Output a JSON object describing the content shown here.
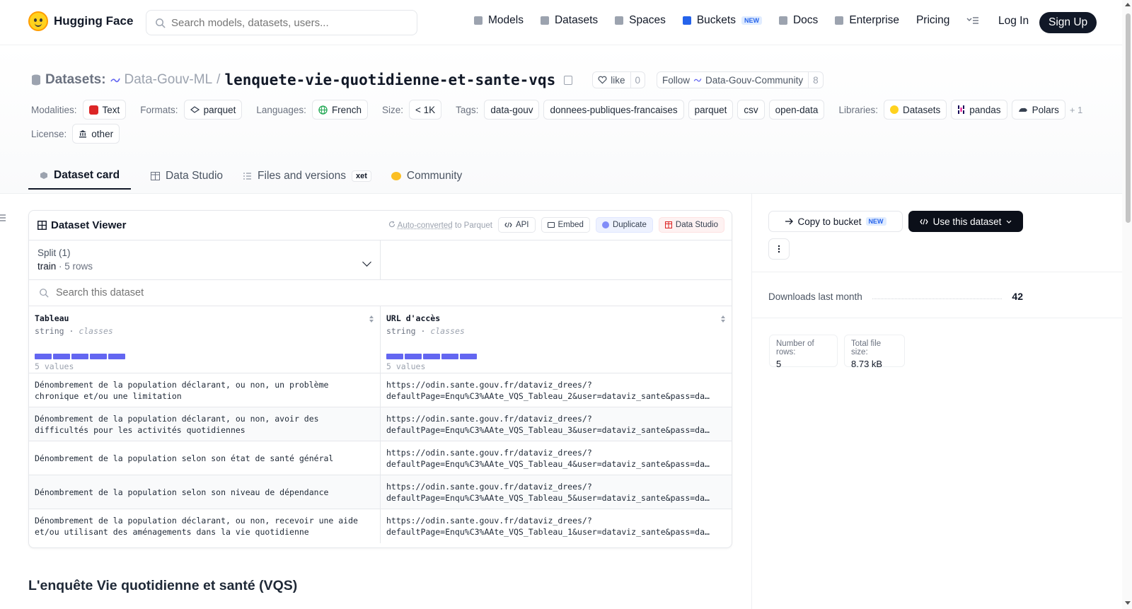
{
  "nav": {
    "brand": "Hugging Face",
    "search_placeholder": "Search models, datasets, users...",
    "links": [
      {
        "label": "Models"
      },
      {
        "label": "Datasets"
      },
      {
        "label": "Spaces"
      },
      {
        "label": "Buckets",
        "badge": "NEW"
      },
      {
        "label": "Docs"
      },
      {
        "label": "Enterprise"
      },
      {
        "label": "Pricing"
      }
    ],
    "login": "Log In",
    "signup": "Sign Up"
  },
  "repo": {
    "type_label": "Datasets:",
    "org": "Data-Gouv-ML",
    "separator": "/",
    "name": "lenquete-vie-quotidienne-et-sante-vqs",
    "like_label": "like",
    "like_count": "0",
    "follow_label": "Follow",
    "follow_org": "Data-Gouv-Community",
    "follow_count": "8"
  },
  "meta": {
    "modalities_label": "Modalities:",
    "modalities": "Text",
    "formats_label": "Formats:",
    "formats": "parquet",
    "languages_label": "Languages:",
    "languages": "French",
    "size_label": "Size:",
    "size": "< 1K",
    "tags_label": "Tags:",
    "tags": [
      "data-gouv",
      "donnees-publiques-francaises",
      "parquet",
      "csv",
      "open-data"
    ],
    "libraries_label": "Libraries:",
    "libraries": [
      "Datasets",
      "pandas",
      "Polars"
    ],
    "libraries_more": "+ 1",
    "license_label": "License:",
    "license": "other"
  },
  "tabs": [
    {
      "label": "Dataset card",
      "active": true
    },
    {
      "label": "Data Studio"
    },
    {
      "label": "Files and versions",
      "badge": "xet"
    },
    {
      "label": "Community"
    }
  ],
  "viewer": {
    "title": "Dataset Viewer",
    "auto_converted": "Auto-converted",
    "auto_converted_suffix": "to Parquet",
    "api": "API",
    "embed": "Embed",
    "duplicate": "Duplicate",
    "data_studio": "Data Studio",
    "split_label": "Split (1)",
    "split_value": "train",
    "split_rows": "5 rows",
    "search_placeholder": "Search this dataset",
    "columns": [
      {
        "name": "Tableau",
        "type": "string",
        "kind": "classes",
        "count": "5 values"
      },
      {
        "name": "URL d'accès",
        "type": "string",
        "kind": "classes",
        "count": "5 values"
      }
    ],
    "rows": [
      {
        "tableau": "Dénombrement de la population déclarant, ou non, un problème chronique et/ou une limitation",
        "url1": "https://odin.sante.gouv.fr/dataviz_drees/?",
        "url2": "defaultPage=Enqu%C3%AAte_VQS_Tableau_2&user=dataviz_sante&pass=da…"
      },
      {
        "tableau": "Dénombrement de la population déclarant, ou non, avoir des difficultés pour les activités quotidiennes",
        "url1": "https://odin.sante.gouv.fr/dataviz_drees/?",
        "url2": "defaultPage=Enqu%C3%AAte_VQS_Tableau_3&user=dataviz_sante&pass=da…"
      },
      {
        "tableau": "Dénombrement de la population selon son état de santé général",
        "url1": "https://odin.sante.gouv.fr/dataviz_drees/?",
        "url2": "defaultPage=Enqu%C3%AAte_VQS_Tableau_4&user=dataviz_sante&pass=da…"
      },
      {
        "tableau": "Dénombrement de la population selon son niveau de dépendance",
        "url1": "https://odin.sante.gouv.fr/dataviz_drees/?",
        "url2": "defaultPage=Enqu%C3%AAte_VQS_Tableau_5&user=dataviz_sante&pass=da…"
      },
      {
        "tableau": "Dénombrement de la population déclarant, ou non, recevoir une aide et/ou utilisant des aménagements dans la vie quotidienne",
        "url1": "https://odin.sante.gouv.fr/dataviz_drees/?",
        "url2": "defaultPage=Enqu%C3%AAte_VQS_Tableau_1&user=dataviz_sante&pass=da…"
      }
    ]
  },
  "card": {
    "heading": "L'enquête Vie quotidienne et santé (VQS)"
  },
  "sidebar": {
    "copy_bucket": "Copy to bucket",
    "copy_bucket_badge": "NEW",
    "use_dataset": "Use this dataset",
    "downloads_label": "Downloads last month",
    "downloads_value": "42",
    "rows_label": "Number of rows:",
    "rows_value": "5",
    "size_label": "Total file size:",
    "size_value": "8.73 kB"
  },
  "colors": {
    "accent": "#6366f1",
    "dark": "#111827",
    "link_blue": "#2563eb"
  }
}
